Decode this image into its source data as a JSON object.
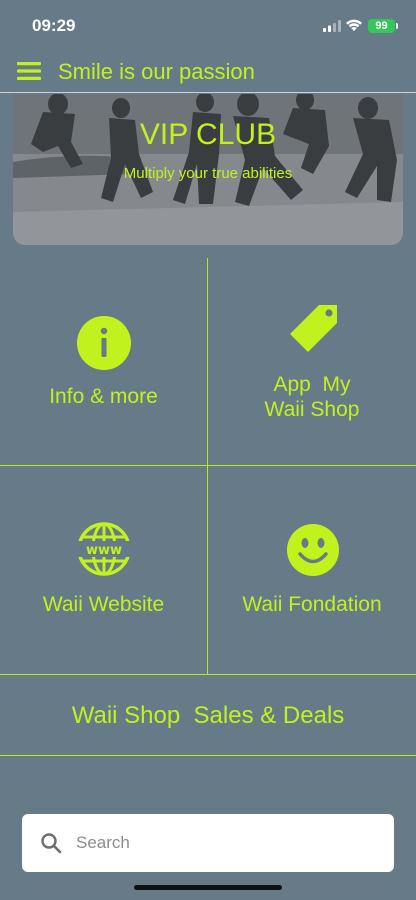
{
  "status_bar": {
    "time": "09:29",
    "battery": "99"
  },
  "header": {
    "title": "Smile is our passion"
  },
  "banner": {
    "title": "VIP CLUB",
    "subtitle": "Multiply your true abilities"
  },
  "tiles": [
    {
      "label": "Info & more",
      "icon": "info-icon"
    },
    {
      "label_line1": "App  My",
      "label_line2": "Waii Shop",
      "icon": "tag-icon"
    },
    {
      "label": "Waii Website",
      "icon": "globe-www-icon"
    },
    {
      "label": "Waii Fondation",
      "icon": "smiley-icon"
    }
  ],
  "deals": {
    "label": "Waii Shop  Sales & Deals"
  },
  "search": {
    "placeholder": "Search",
    "value": ""
  },
  "colors": {
    "background": "#677a88",
    "accent": "#c2f21d",
    "battery": "#34c759"
  }
}
